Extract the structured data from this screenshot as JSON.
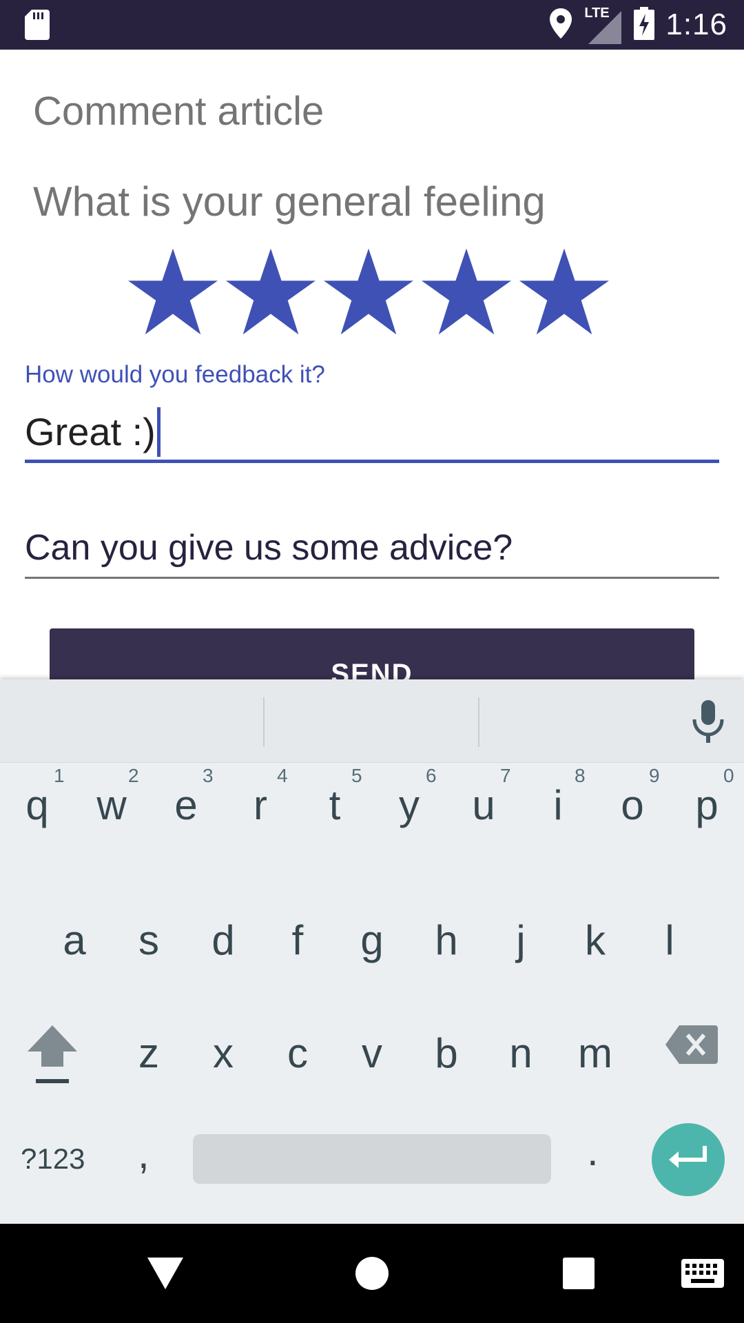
{
  "status_bar": {
    "time": "1:16",
    "network_label": "LTE",
    "icons": [
      "sd-card-icon",
      "location-icon",
      "signal-icon",
      "battery-charging-icon"
    ]
  },
  "screen": {
    "title": "Comment article",
    "feeling_question": "What is your general feeling",
    "rating": {
      "value": 5,
      "max": 5,
      "color": "#3f51b5"
    },
    "feedback": {
      "label": "How would you feedback it?",
      "value": "Great :)"
    },
    "advice": {
      "placeholder": "Can you give us some advice?"
    },
    "send_label": "SEND"
  },
  "keyboard": {
    "row1": [
      {
        "ch": "q",
        "hint": "1"
      },
      {
        "ch": "w",
        "hint": "2"
      },
      {
        "ch": "e",
        "hint": "3"
      },
      {
        "ch": "r",
        "hint": "4"
      },
      {
        "ch": "t",
        "hint": "5"
      },
      {
        "ch": "y",
        "hint": "6"
      },
      {
        "ch": "u",
        "hint": "7"
      },
      {
        "ch": "i",
        "hint": "8"
      },
      {
        "ch": "o",
        "hint": "9"
      },
      {
        "ch": "p",
        "hint": "0"
      }
    ],
    "row2": [
      "a",
      "s",
      "d",
      "f",
      "g",
      "h",
      "j",
      "k",
      "l"
    ],
    "row3": [
      "z",
      "x",
      "c",
      "v",
      "b",
      "n",
      "m"
    ],
    "symbols_label": "?123",
    "comma": ",",
    "period": ".",
    "enter_color": "#4db6ac"
  },
  "nav_bar": {
    "buttons": [
      "back-icon",
      "home-icon",
      "recents-icon",
      "keyboard-switch-icon"
    ]
  },
  "colors": {
    "status_bar": "#28223f",
    "accent": "#3f51b5",
    "button": "#38304f"
  }
}
